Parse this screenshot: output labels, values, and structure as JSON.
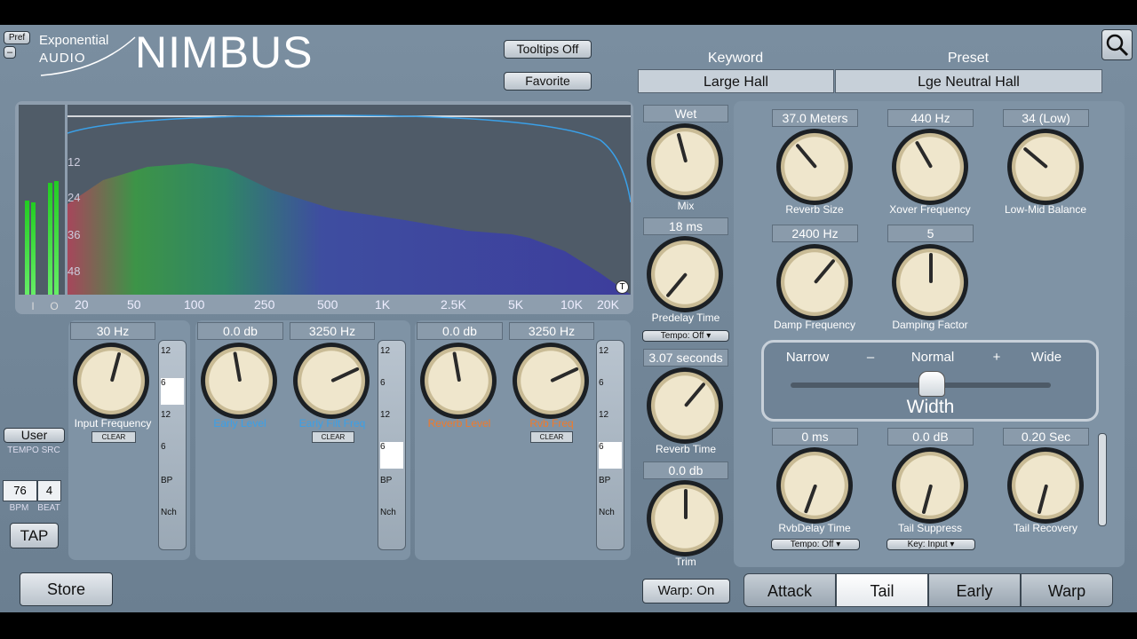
{
  "header": {
    "pref": "Pref",
    "minus": "–",
    "brand_line1": "Exponential",
    "brand_line2": "AUDIO",
    "title": "NIMBUS",
    "tooltips": "Tooltips Off",
    "favorite": "Favorite"
  },
  "browser": {
    "keyword_label": "Keyword",
    "preset_label": "Preset",
    "keyword_value": "Large Hall",
    "preset_value": "Lge Neutral Hall"
  },
  "spectrum": {
    "db_labels": [
      "12",
      "24",
      "36",
      "48"
    ],
    "freq_labels": [
      "20",
      "50",
      "100",
      "250",
      "500",
      "1K",
      "2.5K",
      "5K",
      "10K",
      "20K"
    ],
    "meter_in": "I",
    "meter_out": "O",
    "t_button": "T"
  },
  "center": {
    "wet": "Wet",
    "mix": "Mix",
    "predelay_val": "18 ms",
    "predelay": "Predelay Time",
    "tempo": "Tempo: Off ▾",
    "reverb_time_val": "3.07 seconds",
    "reverb_time": "Reverb Time",
    "trim_val": "0.0 db",
    "trim": "Trim",
    "warp": "Warp: On"
  },
  "filters": {
    "input_freq_val": "30 Hz",
    "input_freq": "Input Frequency",
    "early_level_val": "0.0 db",
    "early_level": "Early Level",
    "early_filt_val": "3250 Hz",
    "early_filt": "Early Filt Freq",
    "reverb_level_val": "0.0 db",
    "reverb_level": "Reverb Level",
    "rvb_freq_val": "3250 Hz",
    "rvb_freq": "Rvb Freq",
    "clear": "CLEAR",
    "slope_labels": [
      "12",
      "6",
      "12",
      "6",
      "BP",
      "Nch"
    ]
  },
  "tempo_src": {
    "user": "User",
    "label": "TEMPO SRC",
    "bpm": "76",
    "beat": "4",
    "bpm_label": "BPM",
    "beat_label": "BEAT",
    "tap": "TAP"
  },
  "store": "Store",
  "right": {
    "reverb_size_val": "37.0 Meters",
    "reverb_size": "Reverb Size",
    "xover_val": "440 Hz",
    "xover": "Xover Frequency",
    "lowmid_val": "34 (Low)",
    "lowmid": "Low-Mid Balance",
    "damp_freq_val": "2400 Hz",
    "damp_freq": "Damp Frequency",
    "damp_factor_val": "5",
    "damp_factor": "Damping Factor",
    "width": {
      "narrow": "Narrow",
      "minus": "–",
      "normal": "Normal",
      "plus": "+",
      "wide": "Wide",
      "title": "Width"
    },
    "rvbdelay_val": "0 ms",
    "rvbdelay": "RvbDelay Time",
    "rvbdelay_tempo": "Tempo: Off ▾",
    "tail_suppress_val": "0.0 dB",
    "tail_suppress": "Tail Suppress",
    "key": "Key: Input ▾",
    "tail_recovery_val": "0.20 Sec",
    "tail_recovery": "Tail Recovery"
  },
  "tabs": [
    "Attack",
    "Tail",
    "Early",
    "Warp"
  ],
  "colors": {
    "accent_blue": "#3aa0e8",
    "accent_orange": "#f07a2a",
    "meter_green": "#3ccf3c"
  }
}
